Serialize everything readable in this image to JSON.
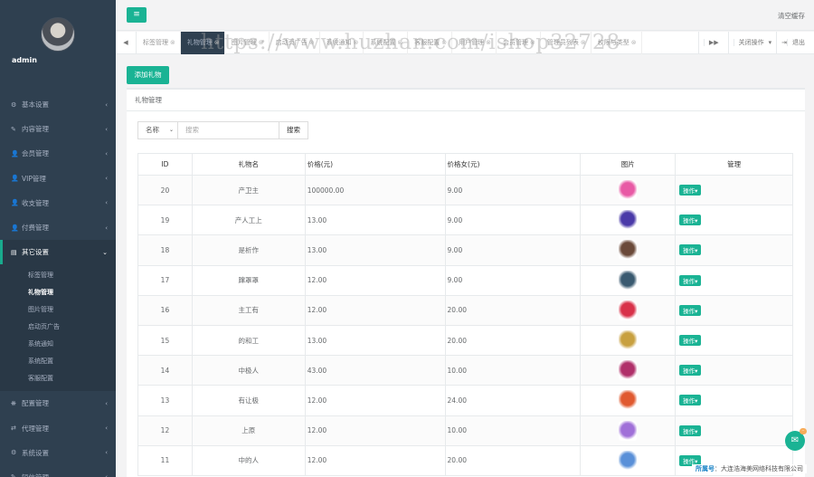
{
  "user": {
    "name": "admin"
  },
  "sidebar": {
    "items": [
      {
        "icon": "⚙",
        "icon_name": "gear-icon",
        "label": "基本设置"
      },
      {
        "icon": "✎",
        "icon_name": "edit-icon",
        "label": "内容管理"
      },
      {
        "icon": "👤",
        "icon_name": "user-icon",
        "label": "会员管理"
      },
      {
        "icon": "👤",
        "icon_name": "user-icon",
        "label": "VIP管理"
      },
      {
        "icon": "👤",
        "icon_name": "user-icon",
        "label": "收支管理"
      },
      {
        "icon": "👤",
        "icon_name": "user-icon",
        "label": "付费管理"
      }
    ],
    "active": {
      "icon": "▤",
      "icon_name": "list-icon",
      "label": "其它设置"
    },
    "sub_items": [
      "标签管理",
      "礼物管理",
      "图片管理",
      "启动页广告",
      "系统通知",
      "系统配置",
      "客服配置"
    ],
    "items_after": [
      {
        "icon": "❋",
        "icon_name": "cogs-icon",
        "label": "配置管理"
      },
      {
        "icon": "⇄",
        "icon_name": "exchange-icon",
        "label": "代理管理"
      },
      {
        "icon": "⚙",
        "icon_name": "cogs-icon",
        "label": "系统设置"
      },
      {
        "icon": "✎",
        "icon_name": "edit-icon",
        "label": "短信管理"
      }
    ]
  },
  "topbar": {
    "menu_icon": "≡",
    "clear_cache": "清空缓存"
  },
  "tabs": {
    "prev": "◀",
    "next": "▶▶",
    "items": [
      "标签管理",
      "礼物管理",
      "图片管理",
      "启动页广告",
      "系统通知",
      "系统配置",
      "客服配置",
      "用户管理",
      "会员管理",
      "管理员列表",
      "权限与类型"
    ],
    "close_ops": "关闭操作",
    "logout": "退出"
  },
  "watermark": "https://www.huzhan.com/ishop32728",
  "page": {
    "add_button": "添加礼物",
    "panel_title": "礼物管理",
    "search": {
      "select": "名称",
      "placeholder": "搜索",
      "button": "搜索"
    }
  },
  "table": {
    "headers": [
      "ID",
      "礼物名",
      "价格(元)",
      "价格女(元)",
      "图片",
      "管理"
    ],
    "op_label": "操作",
    "rows": [
      {
        "id": "20",
        "name": "产卫主",
        "price": "100000.00",
        "price_f": "9.00",
        "color": "#e85aa5"
      },
      {
        "id": "19",
        "name": "产人工上",
        "price": "13.00",
        "price_f": "9.00",
        "color": "#4a3aa8"
      },
      {
        "id": "18",
        "name": "是析作",
        "price": "13.00",
        "price_f": "9.00",
        "color": "#6b4a3a"
      },
      {
        "id": "17",
        "name": "蹿罩罩",
        "price": "12.00",
        "price_f": "9.00",
        "color": "#3a5a70"
      },
      {
        "id": "16",
        "name": "主工有",
        "price": "12.00",
        "price_f": "20.00",
        "color": "#d8324a"
      },
      {
        "id": "15",
        "name": "的和工",
        "price": "13.00",
        "price_f": "20.00",
        "color": "#c8a040"
      },
      {
        "id": "14",
        "name": "中极人",
        "price": "43.00",
        "price_f": "10.00",
        "color": "#b0306a"
      },
      {
        "id": "13",
        "name": "有让极",
        "price": "12.00",
        "price_f": "24.00",
        "color": "#e05a30"
      },
      {
        "id": "12",
        "name": "上原",
        "price": "12.00",
        "price_f": "10.00",
        "color": "#a070d8"
      },
      {
        "id": "11",
        "name": "中的人",
        "price": "12.00",
        "price_f": "20.00",
        "color": "#5a90d8"
      }
    ]
  },
  "footer": {
    "label": "所属号",
    "company": "大连浩海美网络科技有限公司"
  },
  "chat": {
    "icon": "✉",
    "badge": "··"
  }
}
